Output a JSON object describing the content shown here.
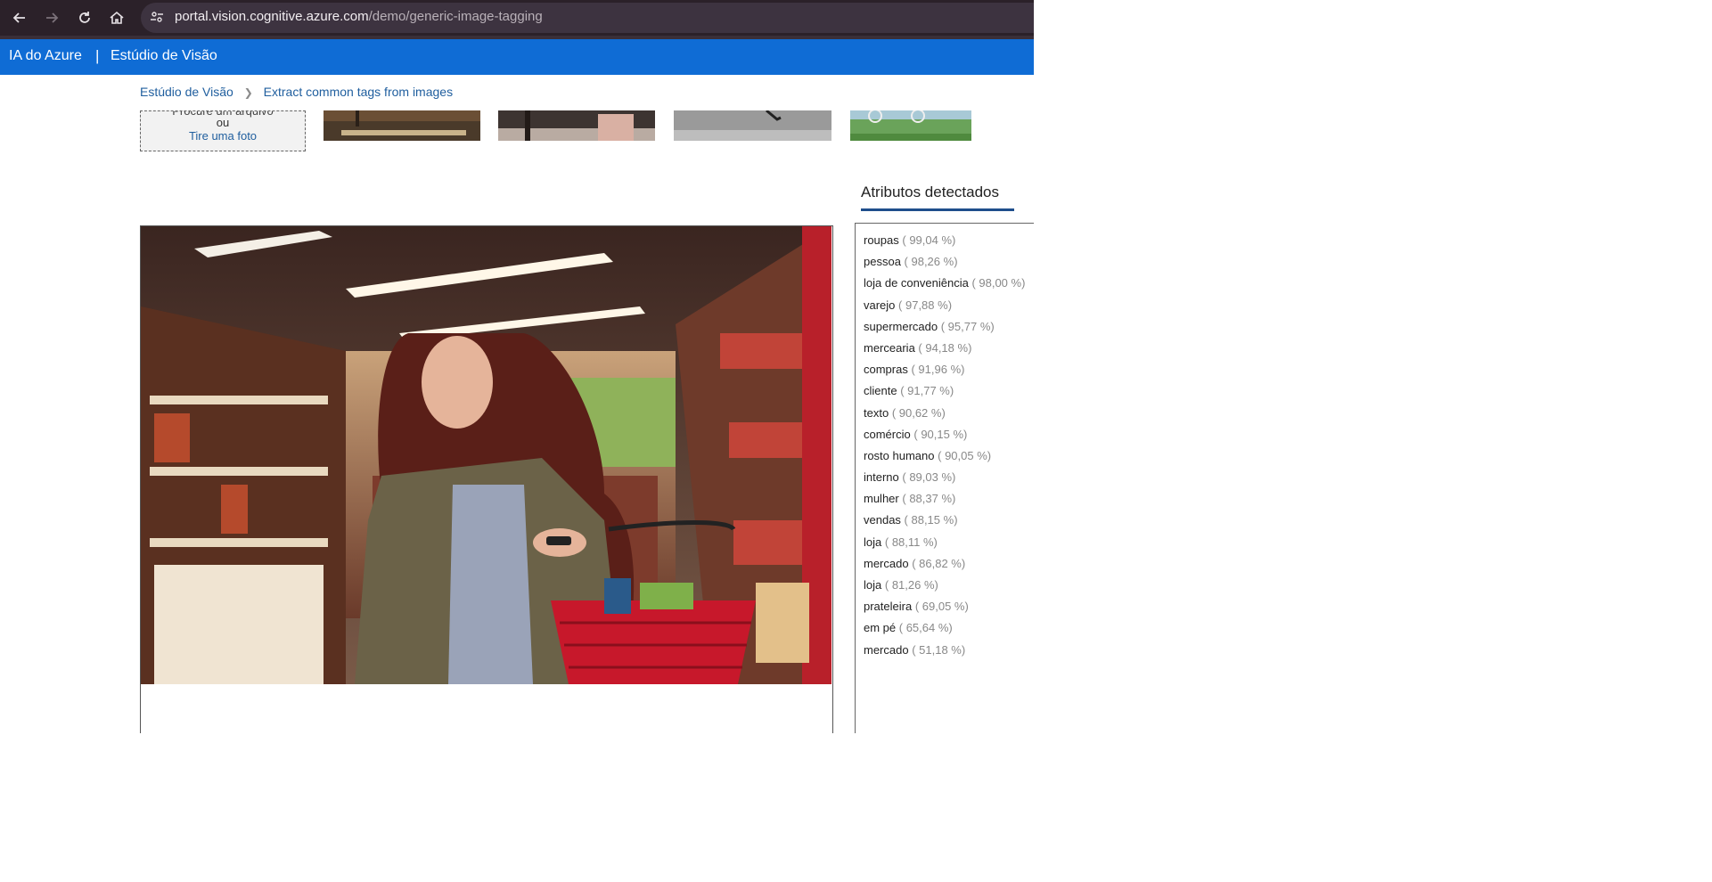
{
  "browser": {
    "url_host": "portal.vision.cognitive.azure.com",
    "url_path": "/demo/generic-image-tagging"
  },
  "header": {
    "brand": "IA do Azure",
    "separator": "|",
    "product": "Estúdio de Visão"
  },
  "breadcrumb": {
    "items": [
      "Estúdio de Visão",
      "Extract common tags from images"
    ],
    "chevron_icon": "chevron-right-icon"
  },
  "upload": {
    "line1": "Procure um arquivo",
    "line2": "ou",
    "line3": "Tire uma foto"
  },
  "tags": {
    "title": "Atributos detectados",
    "items": [
      {
        "name": "roupas",
        "pct": "( 99,04 %)"
      },
      {
        "name": "pessoa",
        "pct": "( 98,26 %)"
      },
      {
        "name": "loja de conveniência",
        "pct": "( 98,00 %)"
      },
      {
        "name": "varejo",
        "pct": "( 97,88 %)"
      },
      {
        "name": "supermercado",
        "pct": "( 95,77 %)"
      },
      {
        "name": "mercearia",
        "pct": "( 94,18 %)"
      },
      {
        "name": "compras",
        "pct": "( 91,96 %)"
      },
      {
        "name": "cliente",
        "pct": "( 91,77 %)"
      },
      {
        "name": "texto",
        "pct": "( 90,62 %)"
      },
      {
        "name": "comércio",
        "pct": "( 90,15 %)"
      },
      {
        "name": "rosto humano",
        "pct": "( 90,05 %)"
      },
      {
        "name": "interno",
        "pct": "( 89,03 %)"
      },
      {
        "name": "mulher",
        "pct": "( 88,37 %)"
      },
      {
        "name": "vendas",
        "pct": "( 88,15 %)"
      },
      {
        "name": "loja",
        "pct": "( 88,11 %)"
      },
      {
        "name": "mercado",
        "pct": "( 86,82 %)"
      },
      {
        "name": "loja",
        "pct": "( 81,26 %)"
      },
      {
        "name": "prateleira",
        "pct": "( 69,05 %)"
      },
      {
        "name": "em pé",
        "pct": "( 65,64 %)"
      },
      {
        "name": "mercado",
        "pct": "( 51,18 %)"
      }
    ]
  },
  "colors": {
    "app_header": "#0f6cd5",
    "browser_bar": "#2b2129",
    "link": "#1f5e9e"
  }
}
